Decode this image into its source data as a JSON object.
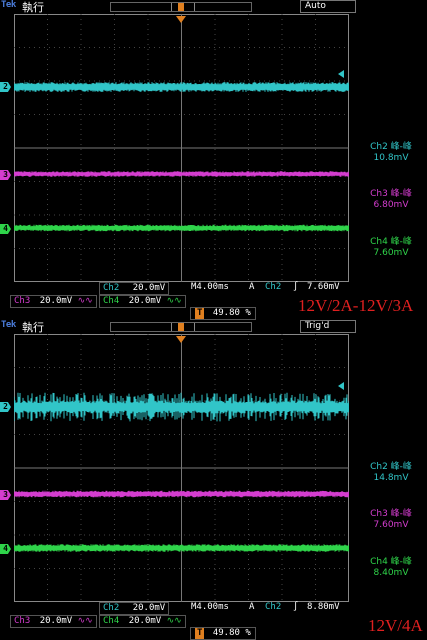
{
  "panels": [
    {
      "id": "panel-1",
      "header": {
        "brand": "Tek",
        "run_state": "執行",
        "status": "Auto"
      },
      "measurements": [
        {
          "name": "Ch2 峰-峰",
          "value": "10.8mV",
          "color": "#31c5c8"
        },
        {
          "name": "Ch3 峰-峰",
          "value": "6.80mV",
          "color": "#d43dcf"
        },
        {
          "name": "Ch4 峰-峰",
          "value": "7.60mV",
          "color": "#2fd44a"
        }
      ],
      "footer": {
        "ch2_label": "Ch2",
        "ch2_scale": "20.0mV",
        "timebase": "M4.00ms",
        "trig_mode": "A",
        "trig_ch": "Ch2",
        "trig_slope": "∫",
        "trig_level": "7.60mV",
        "ch3_label": "Ch3",
        "ch3_scale": "20.0mV",
        "ch4_label": "Ch4",
        "ch4_scale": "20.0mV",
        "bw_symbol": "∿∿",
        "trig_pos_marker": "T",
        "trig_pos": "49.80 %"
      },
      "caption": "12V/2A-12V/3A"
    },
    {
      "id": "panel-2",
      "header": {
        "brand": "Tek",
        "run_state": "執行",
        "status": "Trig'd"
      },
      "measurements": [
        {
          "name": "Ch2 峰-峰",
          "value": "14.8mV",
          "color": "#31c5c8"
        },
        {
          "name": "Ch3 峰-峰",
          "value": "7.60mV",
          "color": "#d43dcf"
        },
        {
          "name": "Ch4 峰-峰",
          "value": "8.40mV",
          "color": "#2fd44a"
        }
      ],
      "footer": {
        "ch2_label": "Ch2",
        "ch2_scale": "20.0mV",
        "timebase": "M4.00ms",
        "trig_mode": "A",
        "trig_ch": "Ch2",
        "trig_slope": "∫",
        "trig_level": "8.80mV",
        "ch3_label": "Ch3",
        "ch3_scale": "20.0mV",
        "ch4_label": "Ch4",
        "ch4_scale": "20.0mV",
        "bw_symbol": "∿∿",
        "trig_pos_marker": "T",
        "trig_pos": "49.80 %"
      },
      "caption": "12V/4A"
    }
  ],
  "channel_markers": {
    "ch2": "2",
    "ch3": "3",
    "ch4": "4"
  },
  "colors": {
    "ch2": "#31c5c8",
    "ch3": "#d43dcf",
    "ch4": "#2fd44a",
    "trigger": "#e08020",
    "caption": "#e02020"
  }
}
